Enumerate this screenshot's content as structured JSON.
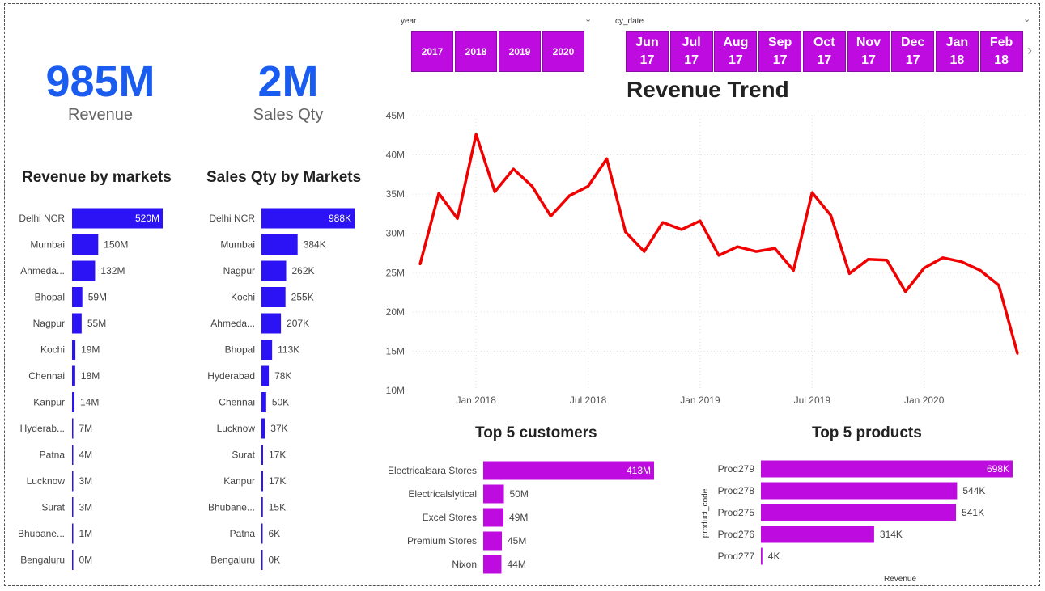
{
  "kpis": {
    "revenue": {
      "value": "985M",
      "label": "Revenue"
    },
    "sales_qty": {
      "value": "2M",
      "label": "Sales Qty"
    }
  },
  "slicers": {
    "year": {
      "header": "year",
      "items": [
        "2017",
        "2018",
        "2019",
        "2020"
      ]
    },
    "cy_date": {
      "header": "cy_date",
      "items": [
        {
          "month": "Jun",
          "yr": "17"
        },
        {
          "month": "Jul",
          "yr": "17"
        },
        {
          "month": "Aug",
          "yr": "17"
        },
        {
          "month": "Sep",
          "yr": "17"
        },
        {
          "month": "Oct",
          "yr": "17"
        },
        {
          "month": "Nov",
          "yr": "17"
        },
        {
          "month": "Dec",
          "yr": "17"
        },
        {
          "month": "Jan",
          "yr": "18"
        },
        {
          "month": "Feb",
          "yr": "18"
        }
      ]
    }
  },
  "chart_data": [
    {
      "id": "revenue_by_markets",
      "type": "bar",
      "orientation": "horizontal",
      "title": "Revenue by markets",
      "color": "#2b13f5",
      "categories": [
        "Delhi NCR",
        "Mumbai",
        "Ahmeda...",
        "Bhopal",
        "Nagpur",
        "Kochi",
        "Chennai",
        "Kanpur",
        "Hyderab...",
        "Patna",
        "Lucknow",
        "Surat",
        "Bhubane...",
        "Bengaluru"
      ],
      "values": [
        520,
        150,
        132,
        59,
        55,
        19,
        18,
        14,
        7,
        4,
        3,
        3,
        1,
        0
      ],
      "labels": [
        "520M",
        "150M",
        "132M",
        "59M",
        "55M",
        "19M",
        "18M",
        "14M",
        "7M",
        "4M",
        "3M",
        "3M",
        "1M",
        "0M"
      ],
      "max": 520
    },
    {
      "id": "sales_qty_by_markets",
      "type": "bar",
      "orientation": "horizontal",
      "title": "Sales Qty by Markets",
      "color": "#2b13f5",
      "categories": [
        "Delhi NCR",
        "Mumbai",
        "Nagpur",
        "Kochi",
        "Ahmeda...",
        "Bhopal",
        "Hyderabad",
        "Chennai",
        "Lucknow",
        "Surat",
        "Kanpur",
        "Bhubane...",
        "Patna",
        "Bengaluru"
      ],
      "values": [
        988,
        384,
        262,
        255,
        207,
        113,
        78,
        50,
        37,
        17,
        17,
        15,
        6,
        0
      ],
      "labels": [
        "988K",
        "384K",
        "262K",
        "255K",
        "207K",
        "113K",
        "78K",
        "50K",
        "37K",
        "17K",
        "17K",
        "15K",
        "6K",
        "0K"
      ],
      "max": 988
    },
    {
      "id": "revenue_trend",
      "type": "line",
      "title": "Revenue Trend",
      "color": "#f00000",
      "x_start": "2017-10",
      "x_ticks": [
        {
          "date": "2018-01",
          "label": "Jan 2018"
        },
        {
          "date": "2018-07",
          "label": "Jul 2018"
        },
        {
          "date": "2019-01",
          "label": "Jan 2019"
        },
        {
          "date": "2019-07",
          "label": "Jul 2019"
        },
        {
          "date": "2020-01",
          "label": "Jan 2020"
        }
      ],
      "y_ticks": [
        "10M",
        "15M",
        "20M",
        "25M",
        "30M",
        "35M",
        "40M",
        "45M"
      ],
      "ylim": [
        10,
        45
      ],
      "y_unit": "M",
      "grid": true,
      "values": [
        26.1,
        35.1,
        31.9,
        42.6,
        35.3,
        38.2,
        36.0,
        32.2,
        34.8,
        36.0,
        39.5,
        30.2,
        27.7,
        31.4,
        30.5,
        31.6,
        27.2,
        28.3,
        27.7,
        28.1,
        25.3,
        35.2,
        32.3,
        24.9,
        26.7,
        26.6,
        22.6,
        25.6,
        26.9,
        26.4,
        25.3,
        23.4,
        14.7
      ]
    },
    {
      "id": "top5_customers",
      "type": "bar",
      "orientation": "horizontal",
      "title": "Top 5 customers",
      "color": "#bd0be0",
      "categories": [
        "Electricalsara Stores",
        "Electricalslytical",
        "Excel Stores",
        "Premium Stores",
        "Nixon"
      ],
      "values": [
        413,
        50,
        49,
        45,
        44
      ],
      "labels": [
        "413M",
        "50M",
        "49M",
        "45M",
        "44M"
      ],
      "max": 413
    },
    {
      "id": "top5_products",
      "type": "bar",
      "orientation": "horizontal",
      "title": "Top 5 products",
      "color": "#bd0be0",
      "categories": [
        "Prod279",
        "Prod278",
        "Prod275",
        "Prod276",
        "Prod277"
      ],
      "values": [
        698,
        544,
        541,
        314,
        4
      ],
      "labels": [
        "698K",
        "544K",
        "541K",
        "314K",
        "4K"
      ],
      "max": 698,
      "xlabel": "Revenue",
      "ylabel": "product_code"
    }
  ]
}
